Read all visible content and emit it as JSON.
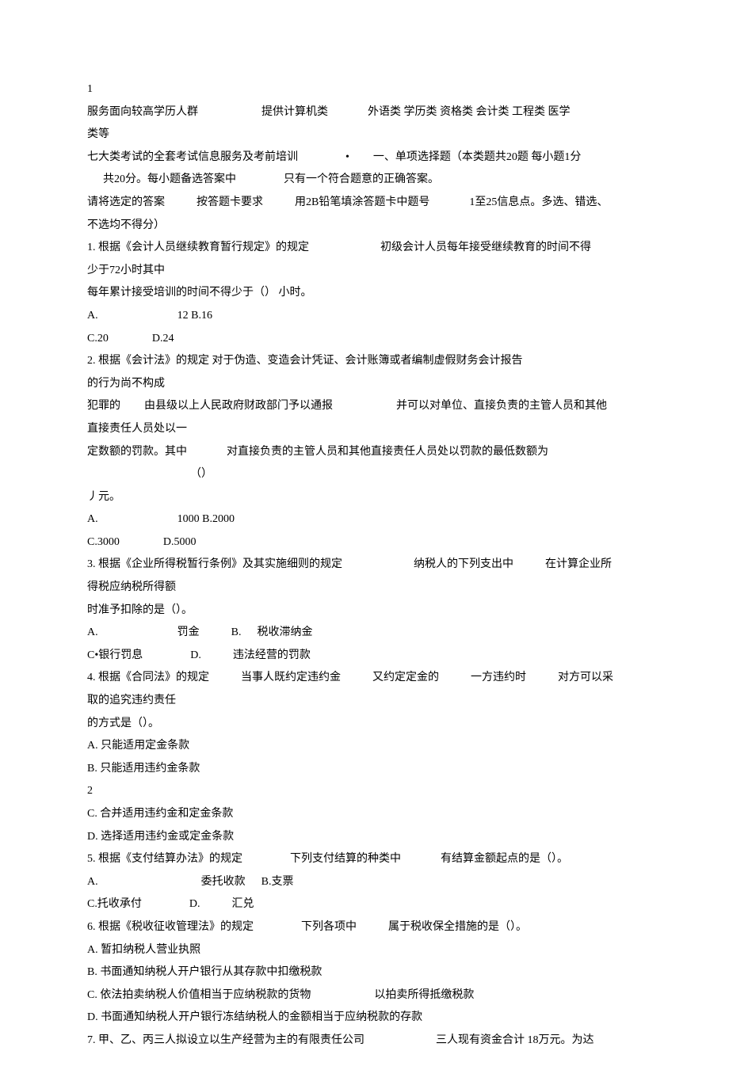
{
  "lines": [
    {
      "segments": [
        {
          "text": "1",
          "pad": 0
        }
      ]
    },
    {
      "segments": [
        {
          "text": "服务面向较高学历人群",
          "pad": 0
        },
        {
          "text": "提供计算机类",
          "pad": 80
        },
        {
          "text": "外语类  学历类  资格类  会计类  工程类  医学",
          "pad": 50
        }
      ]
    },
    {
      "segments": [
        {
          "text": "类等",
          "pad": 0
        }
      ]
    },
    {
      "segments": [
        {
          "text": "七大类考试的全套考试信息服务及考前培训",
          "pad": 0
        },
        {
          "text": "•",
          "pad": 60
        },
        {
          "text": "一、单项选择题（本类题共20题  每小题1分",
          "pad": 30
        }
      ]
    },
    {
      "segments": [
        {
          "text": "共20分。每小题备选答案中",
          "pad": 20
        },
        {
          "text": "只有一个符合题意的正确答案。",
          "pad": 60
        }
      ]
    },
    {
      "segments": [
        {
          "text": "请将选定的答案",
          "pad": 0
        },
        {
          "text": "按答题卡要求",
          "pad": 40
        },
        {
          "text": "用2B铅笔填涂答题卡中题号",
          "pad": 40
        },
        {
          "text": "1至25信息点。多选、错选、",
          "pad": 50
        }
      ]
    },
    {
      "segments": [
        {
          "text": "不选均不得分）",
          "pad": 0
        }
      ]
    },
    {
      "segments": [
        {
          "text": "1.   根据《会计人员继续教育暂行规定》的规定",
          "pad": 0
        },
        {
          "text": "初级会计人员每年接受继续教育的时间不得",
          "pad": 90
        }
      ]
    },
    {
      "segments": [
        {
          "text": "少于72小时其中",
          "pad": 0
        }
      ]
    },
    {
      "segments": [
        {
          "text": "每年累计接受培训的时间不得少于（） 小时。",
          "pad": 0
        }
      ]
    },
    {
      "segments": [
        {
          "text": "A.",
          "pad": 0
        },
        {
          "text": "12 B.16",
          "pad": 100
        }
      ]
    },
    {
      "segments": [
        {
          "text": "C.20",
          "pad": 0
        },
        {
          "text": "D.24",
          "pad": 55
        }
      ]
    },
    {
      "segments": [
        {
          "text": "2.   根据《会计法》的规定  对于伪造、变造会计凭证、会计账簿或者编制虚假财务会计报告",
          "pad": 0
        }
      ]
    },
    {
      "segments": [
        {
          "text": "的行为尚不构成",
          "pad": 0
        }
      ]
    },
    {
      "segments": [
        {
          "text": "犯罪的",
          "pad": 0
        },
        {
          "text": "由县级以上人民政府财政部门予以通报",
          "pad": 30
        },
        {
          "text": "并可以对单位、直接负责的主管人员和其他",
          "pad": 80
        }
      ]
    },
    {
      "segments": [
        {
          "text": "直接责任人员处以一",
          "pad": 0
        }
      ]
    },
    {
      "segments": [
        {
          "text": "定数额的罚款。其中",
          "pad": 0
        },
        {
          "text": "对直接负责的主管人员和其他直接责任人员处以罚款的最低数额为",
          "pad": 50
        }
      ]
    },
    {
      "segments": [
        {
          "text": "（）",
          "pad": 130
        }
      ]
    },
    {
      "segments": [
        {
          "text": "丿元。",
          "pad": 0
        }
      ]
    },
    {
      "segments": [
        {
          "text": "A.",
          "pad": 0
        },
        {
          "text": "1000   B.2000",
          "pad": 100
        }
      ]
    },
    {
      "segments": [
        {
          "text": "C.3000",
          "pad": 0
        },
        {
          "text": "D.5000",
          "pad": 55
        }
      ]
    },
    {
      "segments": [
        {
          "text": "3.  根据《企业所得税暂行条例》及其实施细则的规定",
          "pad": 0
        },
        {
          "text": "纳税人的下列支出中",
          "pad": 90
        },
        {
          "text": "在计算企业所",
          "pad": 40
        }
      ]
    },
    {
      "segments": [
        {
          "text": "得税应纳税所得额",
          "pad": 0
        }
      ]
    },
    {
      "segments": [
        {
          "text": "时准予扣除的是（）。",
          "pad": 0
        }
      ]
    },
    {
      "segments": [
        {
          "text": "A.",
          "pad": 0
        },
        {
          "text": "罚金",
          "pad": 100
        },
        {
          "text": "B.",
          "pad": 40
        },
        {
          "text": "税收滞纳金",
          "pad": 20
        }
      ]
    },
    {
      "segments": [
        {
          "text": "C•银行罚息",
          "pad": 0
        },
        {
          "text": "D.",
          "pad": 60
        },
        {
          "text": "违法经营的罚款",
          "pad": 40
        }
      ]
    },
    {
      "segments": [
        {
          "text": "4.  根据《合同法》的规定",
          "pad": 0
        },
        {
          "text": "当事人既约定违约金",
          "pad": 40
        },
        {
          "text": "又约定定金的",
          "pad": 40
        },
        {
          "text": "一方违约时",
          "pad": 40
        },
        {
          "text": "对方可以采",
          "pad": 40
        }
      ]
    },
    {
      "segments": [
        {
          "text": "取的追究违约责任",
          "pad": 0
        }
      ]
    },
    {
      "segments": [
        {
          "text": "的方式是（）。",
          "pad": 0
        }
      ]
    },
    {
      "segments": [
        {
          "text": "A.   只能适用定金条款",
          "pad": 0
        }
      ]
    },
    {
      "segments": [
        {
          "text": "B.   只能适用违约金条款",
          "pad": 0
        }
      ]
    },
    {
      "segments": [
        {
          "text": "2",
          "pad": 0
        }
      ]
    },
    {
      "segments": [
        {
          "text": "C.   合并适用违约金和定金条款",
          "pad": 0
        }
      ]
    },
    {
      "segments": [
        {
          "text": "D.   选择适用违约金或定金条款",
          "pad": 0
        }
      ]
    },
    {
      "segments": [
        {
          "text": "5.  根据《支付结算办法》的规定",
          "pad": 0
        },
        {
          "text": "下列支付结算的种类中",
          "pad": 60
        },
        {
          "text": "有结算金额起点的是（）。",
          "pad": 50
        }
      ]
    },
    {
      "segments": [
        {
          "text": "A.",
          "pad": 0
        },
        {
          "text": "委托收款",
          "pad": 130
        },
        {
          "text": "B.支票",
          "pad": 20
        }
      ]
    },
    {
      "segments": [
        {
          "text": "C.托收承付",
          "pad": 0
        },
        {
          "text": "D.",
          "pad": 60
        },
        {
          "text": "汇兑",
          "pad": 40
        }
      ]
    },
    {
      "segments": [
        {
          "text": "6.   根据《税收征收管理法》的规定",
          "pad": 0
        },
        {
          "text": "下列各项中",
          "pad": 60
        },
        {
          "text": "属于税收保全措施的是（）。",
          "pad": 40
        }
      ]
    },
    {
      "segments": [
        {
          "text": "A.   暂扣纳税人营业执照",
          "pad": 0
        }
      ]
    },
    {
      "segments": [
        {
          "text": "B.   书面通知纳税人开户银行从其存款中扣缴税款",
          "pad": 0
        }
      ]
    },
    {
      "segments": [
        {
          "text": "C.   依法拍卖纳税人价值相当于应纳税款的货物",
          "pad": 0
        },
        {
          "text": "以拍卖所得抵缴税款",
          "pad": 80
        }
      ]
    },
    {
      "segments": [
        {
          "text": "D.   书面通知纳税人开户银行冻结纳税人的金额相当于应纳税款的存款",
          "pad": 0
        }
      ]
    },
    {
      "segments": [
        {
          "text": "7.   甲、乙、丙三人拟设立以生产经营为主的有限责任公司",
          "pad": 0
        },
        {
          "text": "三人现有资金合计  18万元。为达",
          "pad": 90
        }
      ]
    }
  ]
}
